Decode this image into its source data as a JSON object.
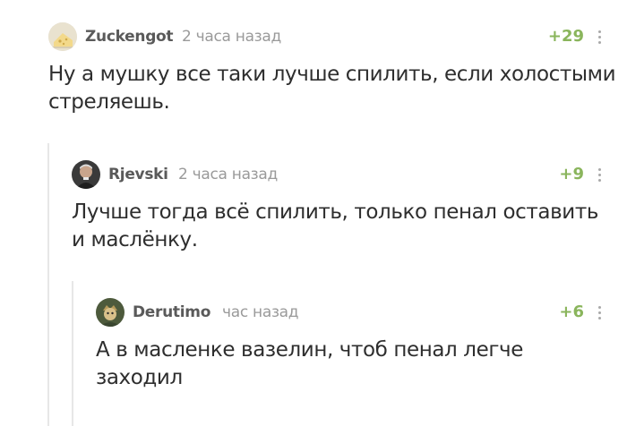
{
  "comments": [
    {
      "username": "Zuckengot",
      "time": "2 часа назад",
      "rating": "+29",
      "text": "Ну а мушку все таки лучше спилить, если холостыми стреляешь.",
      "avatar": "zuckengot-avatar"
    },
    {
      "username": "Rjevski",
      "time": "2 часа назад",
      "rating": "+9",
      "text": "Лучше тогда всё спилить, только пенал оставить и маслёнку.",
      "avatar": "rjevski-avatar"
    },
    {
      "username": "Derutimo",
      "time": "час назад",
      "rating": "+6",
      "text": "А в масленке вазелин, чтоб пенал легче заходил",
      "avatar": "derutimo-avatar"
    }
  ],
  "colors": {
    "rating": "#8ab55c",
    "username": "#5a5a5a",
    "time": "#9a9a9a",
    "thread_line": "#e7e7e7"
  }
}
